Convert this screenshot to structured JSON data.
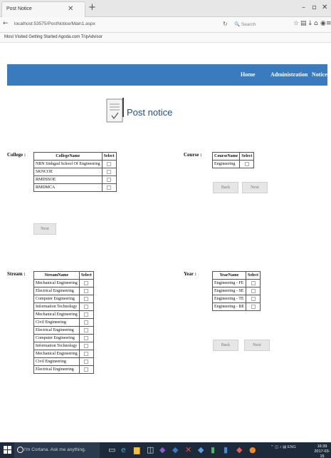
{
  "browser": {
    "tab_title": "Post Notice",
    "url": "localhost:53575/PostNotice/Main1.aspx",
    "search_placeholder": "Search",
    "bookmarks": "Most Visited   Getting Started   Agoda.com   TripAdvisor"
  },
  "header": {
    "nav": [
      "Home",
      "Administration",
      "Notice"
    ]
  },
  "page_title": "Post notice",
  "college": {
    "label": "College :",
    "columns": [
      "CollegeName",
      "Select"
    ],
    "rows": [
      "NBN Sinhgad School Of Engineering",
      "SKNCOE",
      "RMDSSOE",
      "RMDMCA"
    ],
    "next_button": "Next"
  },
  "course": {
    "label": "Course :",
    "columns": [
      "CourseName",
      "Select"
    ],
    "rows": [
      "Engineering"
    ],
    "back_button": "Back",
    "next_button": "Next"
  },
  "stream": {
    "label": "Stream :",
    "columns": [
      "StreamName",
      "Select"
    ],
    "rows": [
      "Mechanical Engineering",
      "Electrical Engineering",
      "Computer Engineering",
      "Information Technology",
      "Mechanical Engineering",
      "Civil Engineering",
      "Electrical Engineering",
      "Computer Engineering",
      "Information Technology",
      "Mechanical Engineering",
      "Civil Engineering",
      "Electrical Engineering"
    ]
  },
  "year": {
    "label": "Year :",
    "columns": [
      "YearName",
      "Select"
    ],
    "rows": [
      "Engineering - FE",
      "Engineering - SE",
      "Engineering - TE",
      "Engineering - BE"
    ],
    "back_button": "Back",
    "next_button": "Next"
  },
  "taskbar": {
    "cortana": "I'm Cortana. Ask me anything.",
    "tray_lang": "ENG",
    "time": "16:39",
    "date": "2017-03-15"
  },
  "colors": {
    "header_bg": "#3a7bbd",
    "title_color": "#1d4f8a",
    "taskbar_bg": "#1d2a3a"
  }
}
